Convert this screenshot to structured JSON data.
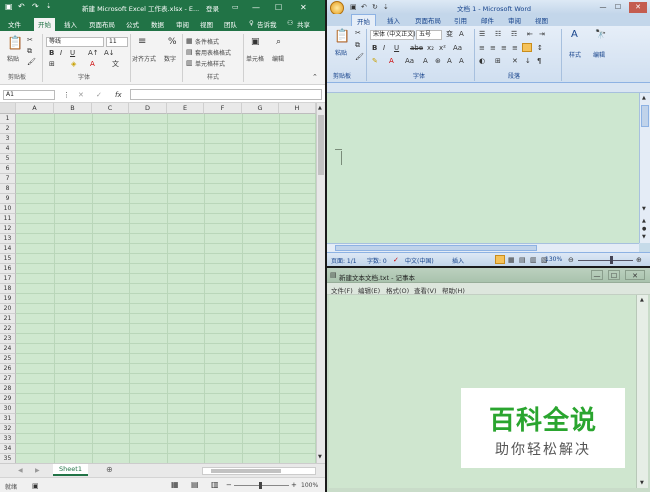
{
  "excel": {
    "title": "新建 Microsoft Excel 工作表.xlsx - E...",
    "login": "登录",
    "tabs": [
      "文件",
      "开始",
      "插入",
      "页面布局",
      "公式",
      "数据",
      "审阅",
      "视图",
      "团队"
    ],
    "tell_me": "告诉我",
    "share": "共享",
    "ribbon": {
      "paste": "粘贴",
      "font_name": "等线",
      "font_size": "11",
      "align": "对齐方式",
      "number": "数字",
      "cond_format": "条件格式",
      "table_format": "套用表格格式",
      "cell_style": "单元格样式",
      "cells": "单元格",
      "edit": "编辑",
      "group_clipboard": "剪贴板",
      "group_font": "字体",
      "group_style": "样式"
    },
    "name_box": "A1",
    "fx": "fx",
    "columns": [
      "A",
      "B",
      "C",
      "D",
      "E",
      "F",
      "G",
      "H"
    ],
    "rows": [
      "1",
      "2",
      "3",
      "4",
      "5",
      "6",
      "7",
      "8",
      "9",
      "10",
      "11",
      "12",
      "13",
      "14",
      "15",
      "16",
      "17",
      "18",
      "19",
      "20",
      "21",
      "22",
      "23",
      "24",
      "25",
      "26",
      "27",
      "28",
      "29",
      "30",
      "31",
      "32",
      "33",
      "34",
      "35"
    ],
    "sheet_tab": "Sheet1",
    "status_ready": "就绪",
    "zoom": "100%"
  },
  "word": {
    "title": "文档 1 - Microsoft Word",
    "tabs": [
      "开始",
      "插入",
      "页面布局",
      "引用",
      "邮件",
      "审阅",
      "视图"
    ],
    "ribbon": {
      "paste": "粘贴",
      "font_name": "宋体 (中文正文)",
      "font_size": "五号",
      "style": "样式",
      "edit": "编辑",
      "group_clipboard": "剪贴板",
      "group_font": "字体",
      "group_paragraph": "段落"
    },
    "status": {
      "page": "页面: 1/1",
      "words": "字数: 0",
      "lang": "中文(中国)",
      "insert": "插入",
      "zoom": "130%"
    }
  },
  "notepad": {
    "title": "新建文本文档.txt - 记事本",
    "menu": [
      "文件(F)",
      "编辑(E)",
      "格式(O)",
      "查看(V)",
      "帮助(H)"
    ]
  },
  "watermark": {
    "main": "百科全说",
    "sub": "助你轻松解决"
  },
  "colors": {
    "excel_green": "#217346",
    "grid_bg": "#cfe8cf",
    "word_blue": "#c3d6ea",
    "watermark_green": "#2aa52f"
  }
}
